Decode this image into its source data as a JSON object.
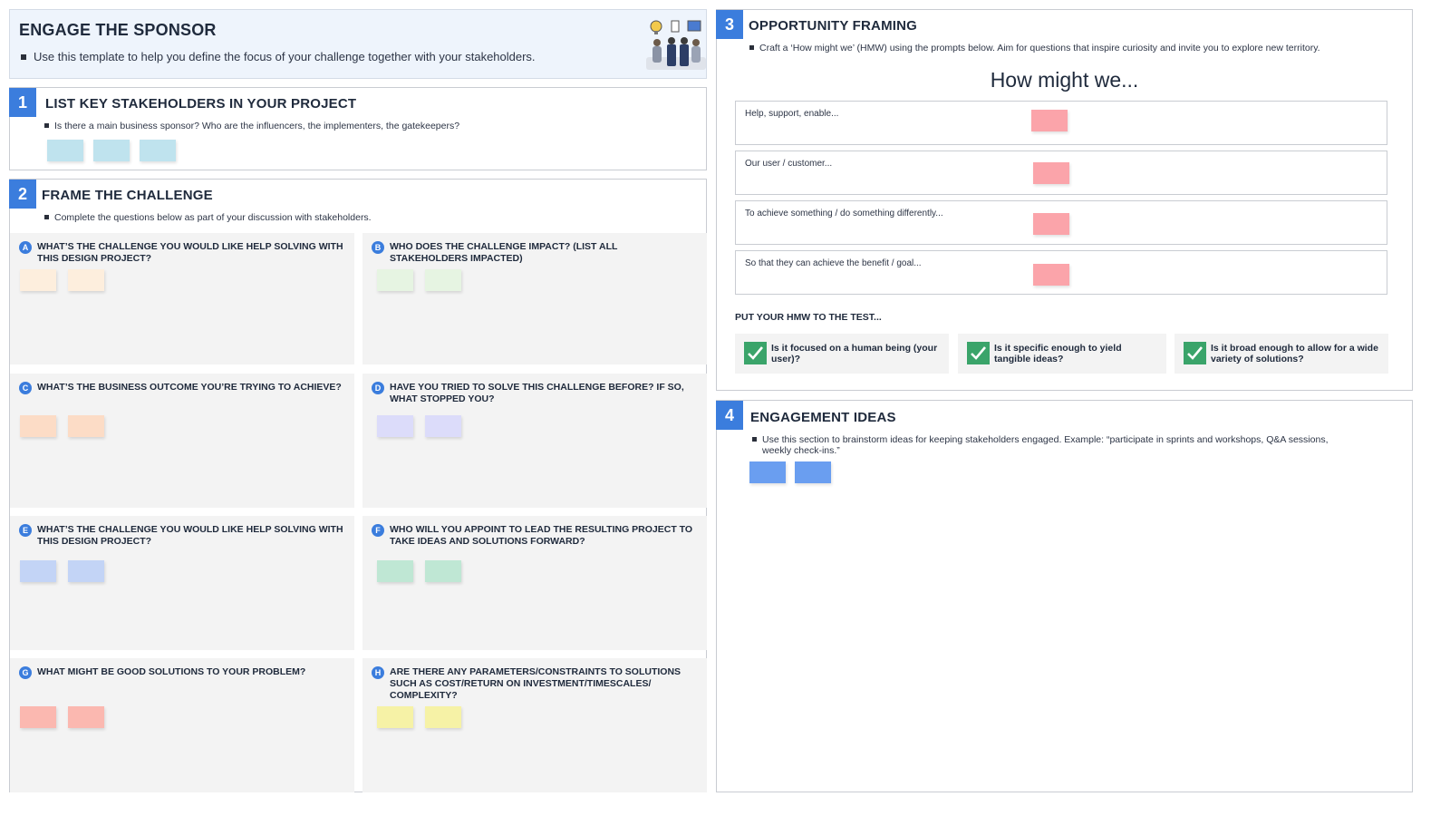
{
  "header": {
    "title": "ENGAGE THE SPONSOR",
    "subtitle": "Use this template to help you define the focus of your challenge together with your stakeholders."
  },
  "section1": {
    "number": "1",
    "title": "LIST KEY STAKEHOLDERS IN YOUR PROJECT",
    "prompt": "Is there a main business sponsor? Who are the influencers, the implementers, the gatekeepers?",
    "sticky_color": "#bfe3ee"
  },
  "section2": {
    "number": "2",
    "title": "FRAME THE CHALLENGE",
    "prompt": "Complete the questions below as part of your discussion with stakeholders.",
    "questions": [
      {
        "letter": "A",
        "text": "WHAT’S THE CHALLENGE YOU WOULD LIKE HELP SOLVING WITH THIS DESIGN PROJECT?",
        "sticky_color": "#fdeedd"
      },
      {
        "letter": "B",
        "text": "WHO DOES THE CHALLENGE IMPACT? (LIST ALL STAKEHOLDERS IMPACTED)",
        "sticky_color": "#e6f4e2"
      },
      {
        "letter": "C",
        "text": "WHAT’S THE BUSINESS OUTCOME YOU’RE TRYING TO ACHIEVE?",
        "sticky_color": "#fcdcc6"
      },
      {
        "letter": "D",
        "text": "HAVE YOU TRIED TO SOLVE THIS CHALLENGE BEFORE? IF SO, WHAT STOPPED YOU?",
        "sticky_color": "#dcdcfa"
      },
      {
        "letter": "E",
        "text": "WHAT’S THE CHALLENGE YOU WOULD LIKE HELP SOLVING WITH THIS DESIGN PROJECT?",
        "sticky_color": "#c3d4f6"
      },
      {
        "letter": "F",
        "text": "WHO WILL YOU APPOINT TO LEAD THE RESULTING PROJECT TO TAKE IDEAS AND SOLUTIONS FORWARD?",
        "sticky_color": "#bfe7d4"
      },
      {
        "letter": "G",
        "text": "WHAT MIGHT BE GOOD SOLUTIONS TO YOUR PROBLEM?",
        "sticky_color": "#fbb8b0"
      },
      {
        "letter": "H",
        "text": "ARE THERE ANY PARAMETERS/CONSTRAINTS TO SOLUTIONS SUCH AS COST/RETURN ON INVESTMENT/TIMESCALES/ COMPLEXITY?",
        "sticky_color": "#f6f2a6"
      }
    ]
  },
  "section3": {
    "number": "3",
    "title": "OPPORTUNITY FRAMING",
    "prompt": "Craft a ‘How might we’ (HMW) using the prompts below. Aim for questions that inspire curiosity and invite you to explore new territory.",
    "hmw_heading": "How might we...",
    "rows": [
      {
        "label": "Help, support, enable..."
      },
      {
        "label": "Our user / customer..."
      },
      {
        "label": "To achieve something / do something differently..."
      },
      {
        "label": "So that they can achieve the benefit / goal..."
      }
    ],
    "sticky_color": "#fba4aa",
    "test_title": "PUT YOUR HMW TO THE TEST...",
    "tests": [
      {
        "text": "Is it focused on a human being (your user)?"
      },
      {
        "text": "Is it specific enough to yield tangible ideas?"
      },
      {
        "text": "Is it broad enough to allow for a wide variety of solutions?"
      }
    ]
  },
  "section4": {
    "number": "4",
    "title": "ENGAGEMENT IDEAS",
    "prompt": "Use this section to brainstorm ideas for keeping stakeholders engaged.  Example: “participate in sprints and workshops, Q&A sessions, weekly check-ins.”",
    "sticky_color": "#6a9ef0"
  },
  "colors": {
    "accent": "#3b7ddd",
    "check": "#3aa46a"
  }
}
